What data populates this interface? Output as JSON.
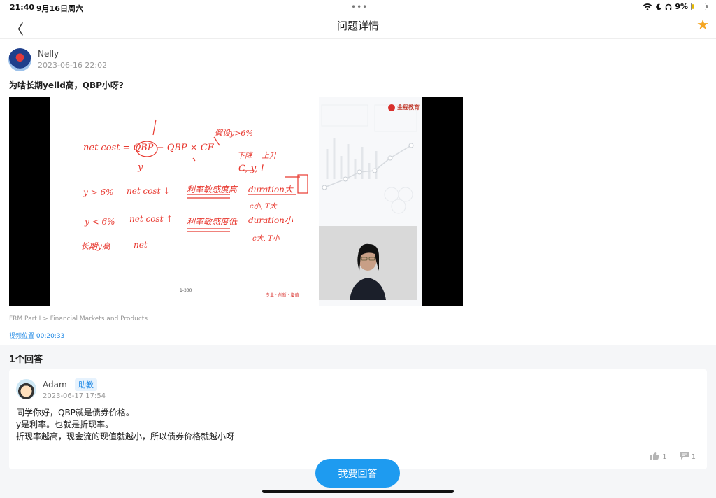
{
  "status_bar": {
    "time": "21:40",
    "date": "9月16日周六",
    "dots": "•••",
    "battery_percent": "9%",
    "battery_level": 0.09,
    "icons": [
      "wifi-icon",
      "moon-icon",
      "headphones-icon",
      "battery-icon"
    ]
  },
  "nav": {
    "back_glyph": "〈",
    "title": "问题详情",
    "favorite_glyph": "★"
  },
  "question": {
    "user": "Nelly",
    "time": "2023-06-16 22:02",
    "text": "为啥长期yeild高，QBP小呀?",
    "breadcrumb": "FRM Part I > Financial Markets and Products",
    "video_position": "视频位置 00:20:33",
    "slide": {
      "logo": "金程教育",
      "page": "1-300",
      "motto": "专业 · 创新 · 增值",
      "notes": [
        "net cost = QBP − QBP × CF",
        "假设y>6%",
        "y",
        "下降",
        "上升",
        "C, y, I",
        "y > 6%",
        "net cost ↓",
        "利率敏感度高",
        "duration大",
        "c小, T大",
        "y < 6%",
        "net cost ↑",
        "利率敏感度低",
        "duration小",
        "c大, T小",
        "长期y高",
        "net"
      ]
    }
  },
  "answers": {
    "count_label": "1个回答",
    "items": [
      {
        "user": "Adam",
        "role": "助教",
        "time": "2023-06-17 17:54",
        "lines": [
          "同学你好，QBP就是债券价格。",
          "y是利率。也就是折现率。",
          "折现率越高，现金流的现值就越小，所以债券价格就越小呀"
        ],
        "likes": "1",
        "comments": "1"
      }
    ]
  },
  "reply_button": "我要回答",
  "colors": {
    "accent": "#1e9bf0",
    "link": "#1e88e5",
    "star": "#f5a623",
    "handwriting": "#e8382f"
  }
}
